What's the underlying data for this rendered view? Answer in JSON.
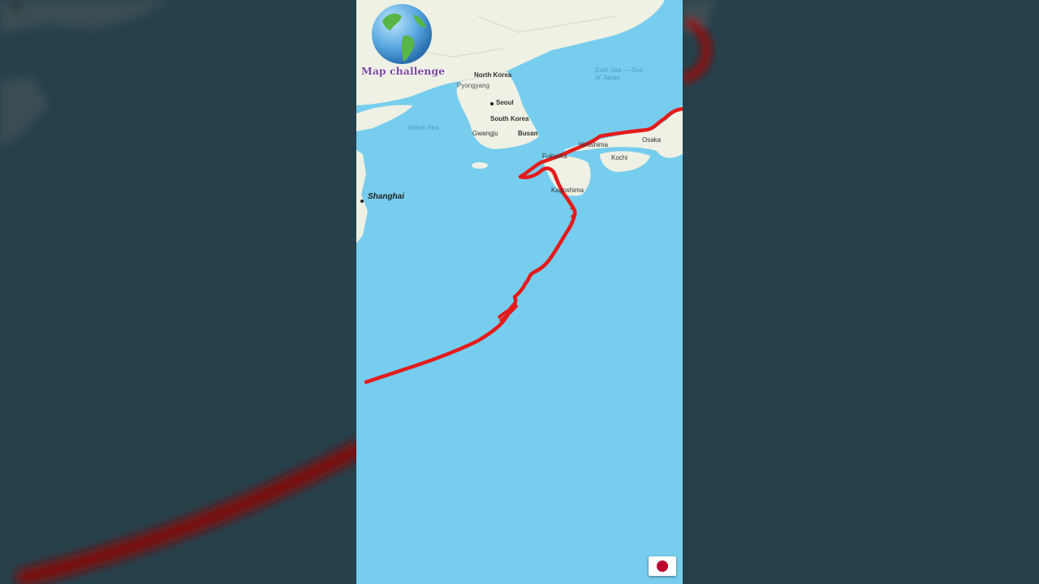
{
  "channel": {
    "name": "Map challenge",
    "logo_icon": "globe-icon"
  },
  "map": {
    "places": [
      "North Korea",
      "Seoul",
      "South Korea",
      "Gwangju",
      "Busan",
      "Shanghai",
      "Fukuoka",
      "Hiroshima",
      "Osaka",
      "Kochi",
      "Kagoshima",
      "Pyongyang"
    ],
    "seas": [
      "Yellow Sea",
      "East Sea — Sea of Japan"
    ],
    "route_color": "#e41b1b",
    "water_color": "#76cdee",
    "land_color": "#eef1e3"
  },
  "flag": {
    "country": "Japan",
    "icon": "japan-flag-icon"
  }
}
